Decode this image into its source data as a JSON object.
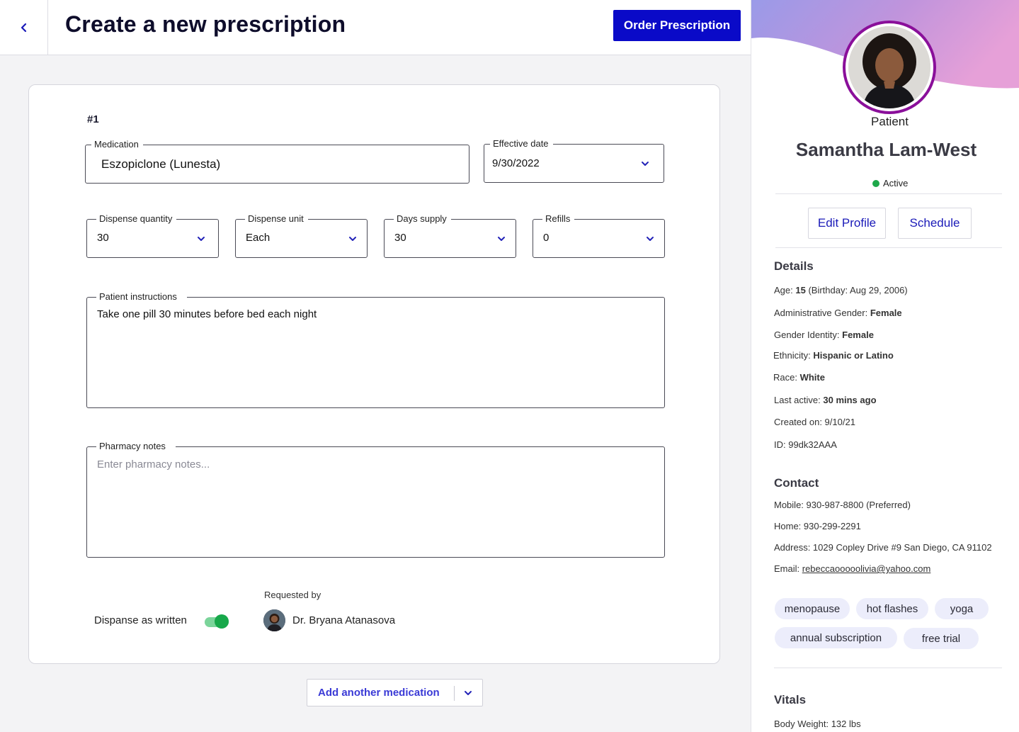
{
  "header": {
    "title": "Create a new prescription",
    "order_button": "Order Prescription"
  },
  "prescription": {
    "number": "#1",
    "medication": {
      "label": "Medication",
      "value": "Eszopiclone (Lunesta)"
    },
    "effective_date": {
      "label": "Effective date",
      "value": "9/30/2022"
    },
    "dispense_quantity": {
      "label": "Dispense quantity",
      "value": "30"
    },
    "dispense_unit": {
      "label": "Dispense unit",
      "value": "Each"
    },
    "days_supply": {
      "label": "Days supply",
      "value": "30"
    },
    "refills": {
      "label": "Refills",
      "value": "0"
    },
    "patient_instructions": {
      "label": "Patient instructions",
      "value": "Take one pill 30 minutes before bed each night"
    },
    "pharmacy_notes": {
      "label": "Pharmacy notes",
      "placeholder": "Enter pharmacy notes..."
    },
    "dispense_as_written": {
      "label": "Dispanse as written",
      "on": true
    },
    "requested_by": {
      "label": "Requested by",
      "name": "Dr. Bryana Atanasova"
    }
  },
  "add_medication": {
    "label": "Add another medication"
  },
  "patient": {
    "role": "Patient",
    "name": "Samantha Lam-West",
    "status": "Active",
    "edit_button": "Edit Profile",
    "schedule_button": "Schedule",
    "details_title": "Details",
    "details": [
      {
        "label": "Age: ",
        "value": "15",
        "suffix": " (Birthday: Aug 29, 2006)"
      },
      {
        "label": "Administrative Gender: ",
        "value": "Female",
        "suffix": ""
      },
      {
        "label": "Gender Identity: ",
        "value": "Female",
        "suffix": ""
      },
      {
        "label": "Ethnicity: ",
        "value": "Hispanic or Latino",
        "suffix": ""
      },
      {
        "label": "Race: ",
        "value": "White",
        "suffix": ""
      },
      {
        "label": "Last active: ",
        "value": "30 mins ago",
        "suffix": ""
      },
      {
        "label": "Created on: 9/10/21",
        "value": "",
        "suffix": ""
      },
      {
        "label": "ID: 99dk32AAA",
        "value": "",
        "suffix": ""
      }
    ],
    "contact_title": "Contact",
    "contact": {
      "mobile": "Mobile: 930-987-8800 (Preferred)",
      "home": "Home: 930-299-2291",
      "address": "Address: 1029 Copley Drive #9 San Diego, CA 91102",
      "email_label": "Email: ",
      "email": "rebeccaooooolivia@yahoo.com"
    },
    "tags": [
      "menopause",
      "hot flashes",
      "yoga",
      "annual subscription",
      "free trial"
    ],
    "vitals_title": "Vitals",
    "vitals": {
      "body_weight": "Body Weight: 132 lbs"
    }
  },
  "colors": {
    "primary": "#0a0ac8",
    "link": "#3a3ad6",
    "active": "#1ea84a",
    "avatar_ring": "#8a0f9a",
    "tag_bg": "#ecedfb"
  }
}
